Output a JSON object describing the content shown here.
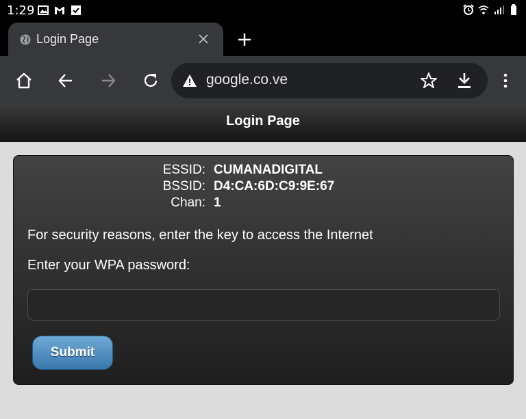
{
  "status_bar": {
    "time": "1:29",
    "left_icons": [
      "image-icon",
      "gmail-icon",
      "checkbox-icon"
    ],
    "right_icons": [
      "alarm-icon",
      "wifi-icon",
      "signal-icon",
      "battery-icon"
    ]
  },
  "browser": {
    "tab": {
      "title": "Login Page",
      "favicon": "globe-icon"
    },
    "toolbar": {
      "url": "google.co.ve",
      "icons": [
        "home-icon",
        "back-arrow-icon",
        "forward-arrow-icon",
        "reload-icon",
        "warning-icon",
        "star-icon",
        "download-icon",
        "menu-icon"
      ]
    }
  },
  "page": {
    "header_title": "Login Page",
    "network": {
      "essid_label": "ESSID:",
      "essid": "CUMANADIGITAL",
      "bssid_label": "BSSID:",
      "bssid": "D4:CA:6D:C9:9E:67",
      "chan_label": "Chan:",
      "chan": "1"
    },
    "security_message": "For security reasons, enter the key to access the Internet",
    "password_prompt": "Enter your WPA password:",
    "password_value": "",
    "submit_label": "Submit"
  },
  "colors": {
    "chrome_dark": "#36383b",
    "omnibox": "#202124",
    "button_blue": "#4a86bb"
  }
}
